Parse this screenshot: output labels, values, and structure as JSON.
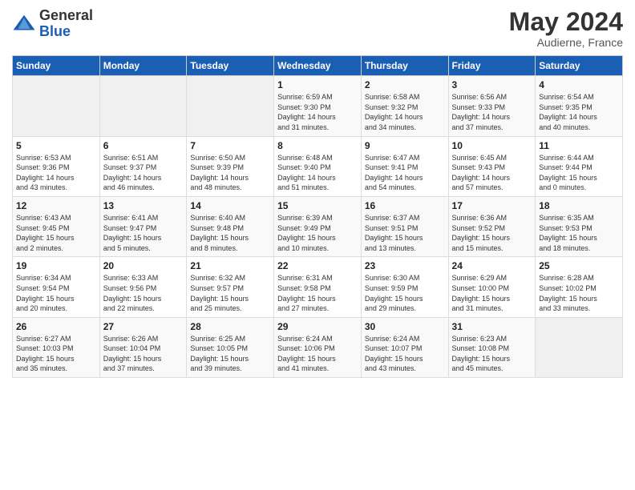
{
  "logo": {
    "general": "General",
    "blue": "Blue"
  },
  "header": {
    "month_year": "May 2024",
    "location": "Audierne, France"
  },
  "days_of_week": [
    "Sunday",
    "Monday",
    "Tuesday",
    "Wednesday",
    "Thursday",
    "Friday",
    "Saturday"
  ],
  "weeks": [
    [
      {
        "day": "",
        "info": ""
      },
      {
        "day": "",
        "info": ""
      },
      {
        "day": "",
        "info": ""
      },
      {
        "day": "1",
        "info": "Sunrise: 6:59 AM\nSunset: 9:30 PM\nDaylight: 14 hours\nand 31 minutes."
      },
      {
        "day": "2",
        "info": "Sunrise: 6:58 AM\nSunset: 9:32 PM\nDaylight: 14 hours\nand 34 minutes."
      },
      {
        "day": "3",
        "info": "Sunrise: 6:56 AM\nSunset: 9:33 PM\nDaylight: 14 hours\nand 37 minutes."
      },
      {
        "day": "4",
        "info": "Sunrise: 6:54 AM\nSunset: 9:35 PM\nDaylight: 14 hours\nand 40 minutes."
      }
    ],
    [
      {
        "day": "5",
        "info": "Sunrise: 6:53 AM\nSunset: 9:36 PM\nDaylight: 14 hours\nand 43 minutes."
      },
      {
        "day": "6",
        "info": "Sunrise: 6:51 AM\nSunset: 9:37 PM\nDaylight: 14 hours\nand 46 minutes."
      },
      {
        "day": "7",
        "info": "Sunrise: 6:50 AM\nSunset: 9:39 PM\nDaylight: 14 hours\nand 48 minutes."
      },
      {
        "day": "8",
        "info": "Sunrise: 6:48 AM\nSunset: 9:40 PM\nDaylight: 14 hours\nand 51 minutes."
      },
      {
        "day": "9",
        "info": "Sunrise: 6:47 AM\nSunset: 9:41 PM\nDaylight: 14 hours\nand 54 minutes."
      },
      {
        "day": "10",
        "info": "Sunrise: 6:45 AM\nSunset: 9:43 PM\nDaylight: 14 hours\nand 57 minutes."
      },
      {
        "day": "11",
        "info": "Sunrise: 6:44 AM\nSunset: 9:44 PM\nDaylight: 15 hours\nand 0 minutes."
      }
    ],
    [
      {
        "day": "12",
        "info": "Sunrise: 6:43 AM\nSunset: 9:45 PM\nDaylight: 15 hours\nand 2 minutes."
      },
      {
        "day": "13",
        "info": "Sunrise: 6:41 AM\nSunset: 9:47 PM\nDaylight: 15 hours\nand 5 minutes."
      },
      {
        "day": "14",
        "info": "Sunrise: 6:40 AM\nSunset: 9:48 PM\nDaylight: 15 hours\nand 8 minutes."
      },
      {
        "day": "15",
        "info": "Sunrise: 6:39 AM\nSunset: 9:49 PM\nDaylight: 15 hours\nand 10 minutes."
      },
      {
        "day": "16",
        "info": "Sunrise: 6:37 AM\nSunset: 9:51 PM\nDaylight: 15 hours\nand 13 minutes."
      },
      {
        "day": "17",
        "info": "Sunrise: 6:36 AM\nSunset: 9:52 PM\nDaylight: 15 hours\nand 15 minutes."
      },
      {
        "day": "18",
        "info": "Sunrise: 6:35 AM\nSunset: 9:53 PM\nDaylight: 15 hours\nand 18 minutes."
      }
    ],
    [
      {
        "day": "19",
        "info": "Sunrise: 6:34 AM\nSunset: 9:54 PM\nDaylight: 15 hours\nand 20 minutes."
      },
      {
        "day": "20",
        "info": "Sunrise: 6:33 AM\nSunset: 9:56 PM\nDaylight: 15 hours\nand 22 minutes."
      },
      {
        "day": "21",
        "info": "Sunrise: 6:32 AM\nSunset: 9:57 PM\nDaylight: 15 hours\nand 25 minutes."
      },
      {
        "day": "22",
        "info": "Sunrise: 6:31 AM\nSunset: 9:58 PM\nDaylight: 15 hours\nand 27 minutes."
      },
      {
        "day": "23",
        "info": "Sunrise: 6:30 AM\nSunset: 9:59 PM\nDaylight: 15 hours\nand 29 minutes."
      },
      {
        "day": "24",
        "info": "Sunrise: 6:29 AM\nSunset: 10:00 PM\nDaylight: 15 hours\nand 31 minutes."
      },
      {
        "day": "25",
        "info": "Sunrise: 6:28 AM\nSunset: 10:02 PM\nDaylight: 15 hours\nand 33 minutes."
      }
    ],
    [
      {
        "day": "26",
        "info": "Sunrise: 6:27 AM\nSunset: 10:03 PM\nDaylight: 15 hours\nand 35 minutes."
      },
      {
        "day": "27",
        "info": "Sunrise: 6:26 AM\nSunset: 10:04 PM\nDaylight: 15 hours\nand 37 minutes."
      },
      {
        "day": "28",
        "info": "Sunrise: 6:25 AM\nSunset: 10:05 PM\nDaylight: 15 hours\nand 39 minutes."
      },
      {
        "day": "29",
        "info": "Sunrise: 6:24 AM\nSunset: 10:06 PM\nDaylight: 15 hours\nand 41 minutes."
      },
      {
        "day": "30",
        "info": "Sunrise: 6:24 AM\nSunset: 10:07 PM\nDaylight: 15 hours\nand 43 minutes."
      },
      {
        "day": "31",
        "info": "Sunrise: 6:23 AM\nSunset: 10:08 PM\nDaylight: 15 hours\nand 45 minutes."
      },
      {
        "day": "",
        "info": ""
      }
    ]
  ]
}
